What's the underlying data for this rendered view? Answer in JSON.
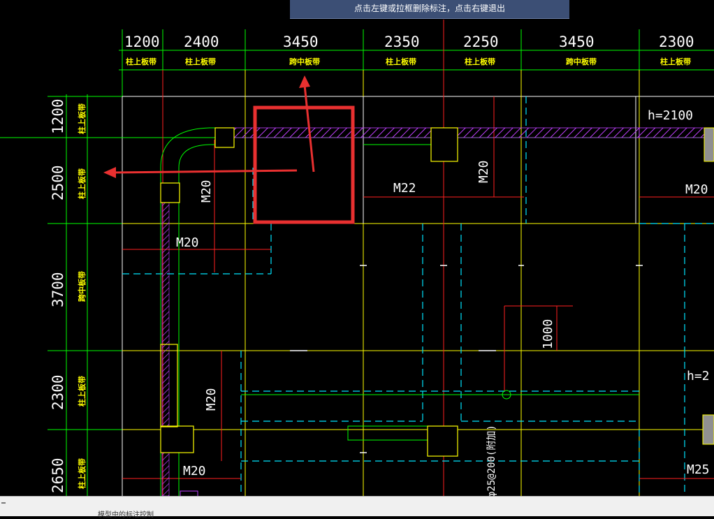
{
  "tooltip": "点击左键或拉框删除标注，点击右键退出",
  "top_dims": [
    "1200",
    "2400",
    "3450",
    "2350",
    "2250",
    "3450",
    "2300"
  ],
  "top_labels": [
    "柱上板带",
    "柱上板带",
    "跨中板带",
    "柱上板带",
    "柱上板带",
    "跨中板带",
    "柱上板带"
  ],
  "left_dims": [
    "1200",
    "2500",
    "3700",
    "2300",
    "2650"
  ],
  "left_labels": [
    "柱上板带",
    "柱上板带",
    "跨中板带",
    "柱上板带",
    "柱上板带"
  ],
  "annotations": {
    "h1": "h=2100",
    "h2": "h=2",
    "m22": "M22",
    "m20_a": "M20",
    "m20_b": "M20",
    "m20_c": "M20",
    "m20_d": "M20",
    "m20_e": "M20",
    "m20_f": "M20",
    "m25": "M25",
    "d1000": "1000",
    "rebar": "φ25@200(附加)"
  },
  "colors": {
    "background": "#000000",
    "grid_green": "#00ff00",
    "axis_red": "#ff2020",
    "yellow": "#ffff00",
    "cyan": "#00e5ff",
    "white": "#ffffff",
    "magenta": "#c040ff",
    "highlight_red": "#e83030",
    "tooltip_bg": "#3c4f75"
  },
  "status": {
    "text": "模型中的标注控制"
  }
}
